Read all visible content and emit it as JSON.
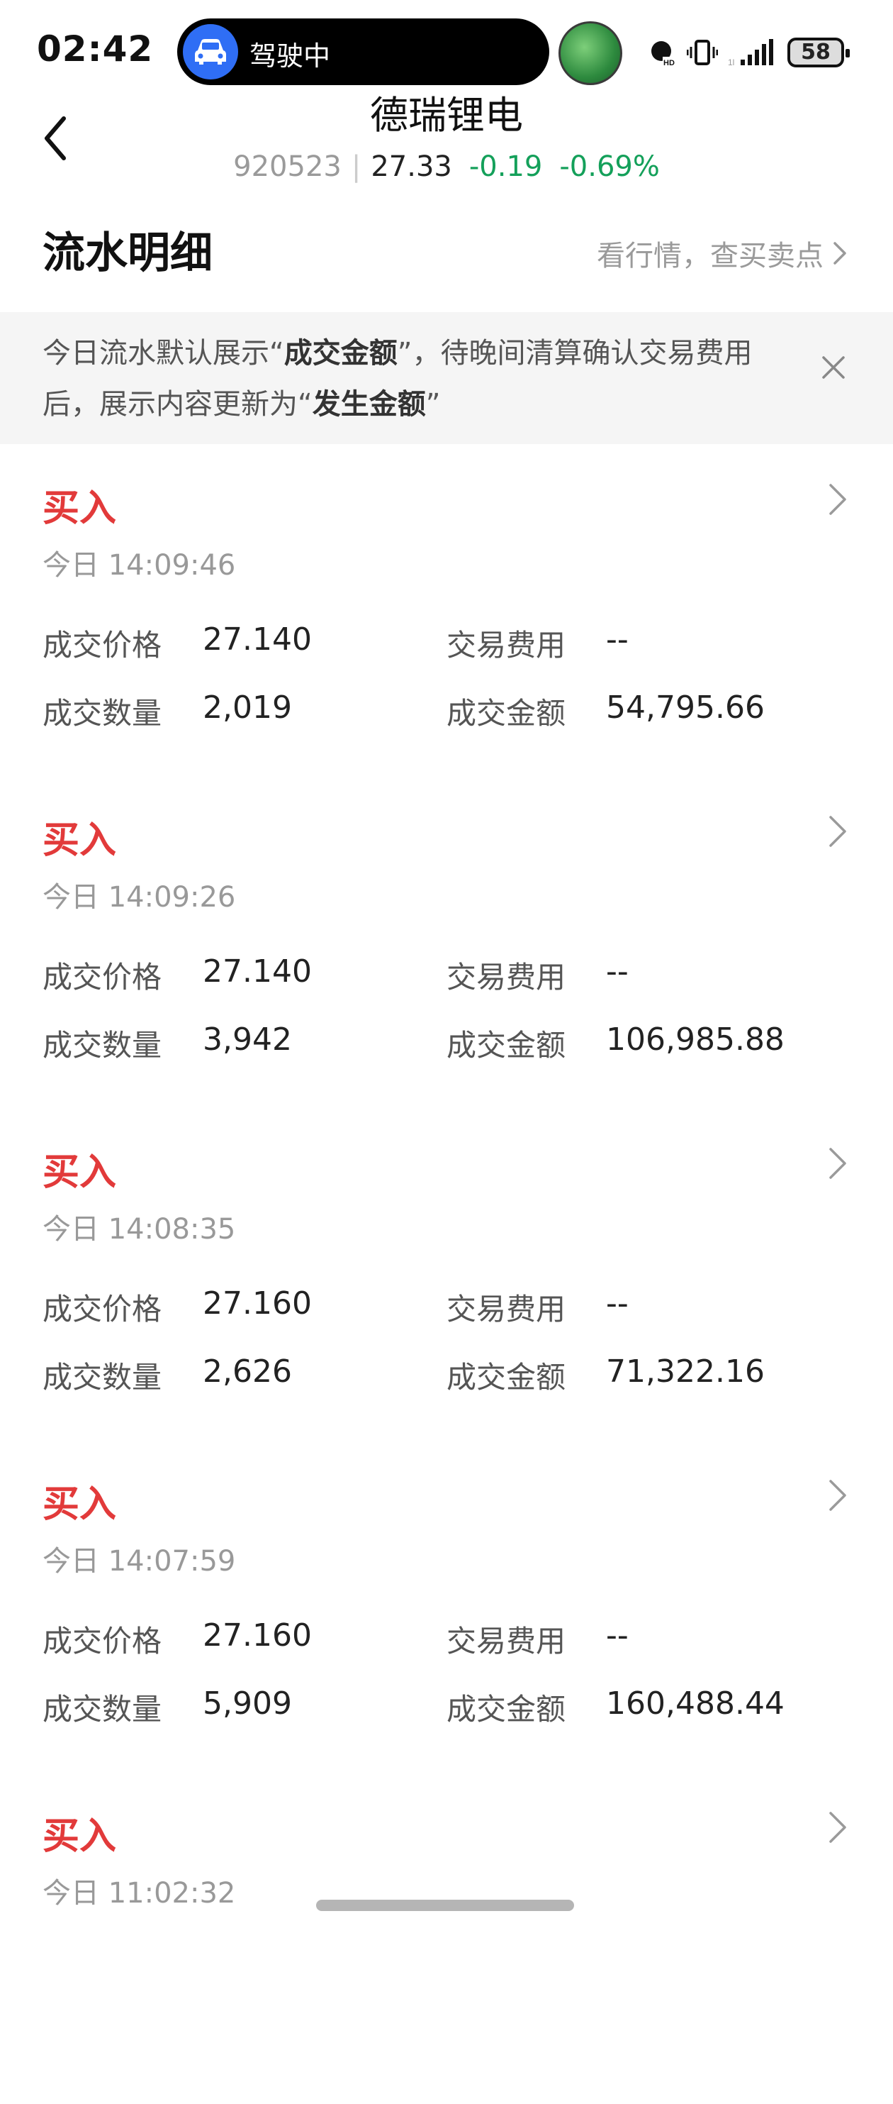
{
  "status_bar": {
    "time": "02:42",
    "activity_label": "驾驶中",
    "battery": "58",
    "icons": [
      "hd-call-icon",
      "vibrate-icon",
      "signal-icon",
      "battery-icon"
    ]
  },
  "header": {
    "stock_name": "德瑞锂电",
    "stock_code": "920523",
    "price": "27.33",
    "change": "-0.19",
    "change_pct": "-0.69%"
  },
  "section": {
    "title": "流水明细",
    "link": "看行情，查买卖点"
  },
  "notice": {
    "part1": "今日流水默认展示“",
    "bold1": "成交金额",
    "part2": "”，待晚间清算确认交易费用后，展示内容更新为“",
    "bold2": "发生金额",
    "part3": "”"
  },
  "labels": {
    "price": "成交价格",
    "fee": "交易费用",
    "qty": "成交数量",
    "amount": "成交金额"
  },
  "records": [
    {
      "type": "买入",
      "time": "今日 14:09:46",
      "price": "27.140",
      "fee": "--",
      "qty": "2,019",
      "amount": "54,795.66"
    },
    {
      "type": "买入",
      "time": "今日 14:09:26",
      "price": "27.140",
      "fee": "--",
      "qty": "3,942",
      "amount": "106,985.88"
    },
    {
      "type": "买入",
      "time": "今日 14:08:35",
      "price": "27.160",
      "fee": "--",
      "qty": "2,626",
      "amount": "71,322.16"
    },
    {
      "type": "买入",
      "time": "今日 14:07:59",
      "price": "27.160",
      "fee": "--",
      "qty": "5,909",
      "amount": "160,488.44"
    },
    {
      "type": "买入",
      "time": "今日 11:02:32",
      "price": "",
      "fee": "",
      "qty": "",
      "amount": ""
    }
  ],
  "colors": {
    "buy": "#e23a3a",
    "down": "#14a05a",
    "accent_blue": "#2f6ef5"
  }
}
